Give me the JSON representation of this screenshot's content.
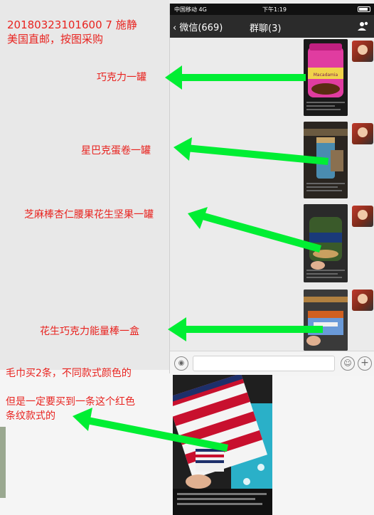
{
  "order": {
    "header_line1": "20180323101600 7  施静",
    "header_line2": "美国直邮，按图采购"
  },
  "phone": {
    "status": {
      "carrier": "中国移动  4G",
      "time": "下午1:19"
    },
    "nav": {
      "back_label": "微信(669)",
      "title": "群聊(3)"
    }
  },
  "items": [
    {
      "label": "巧克力一罐"
    },
    {
      "label": "星巴克蛋卷一罐"
    },
    {
      "label": "芝麻棒杏仁腰果花生坚果一罐"
    },
    {
      "label": "花生巧克力能量棒一盒"
    }
  ],
  "towel_note": {
    "line1": "毛巾买2条，不同款式颜色的",
    "line2": "但是一定要买到一条这个红色",
    "line3": "条纹款式的"
  },
  "photo_labels": {
    "macadamia": "Macadamia"
  },
  "colors": {
    "annotation_red": "#e8231f",
    "arrow_green": "#00ee33",
    "nav_dark": "#2b2b2b"
  }
}
